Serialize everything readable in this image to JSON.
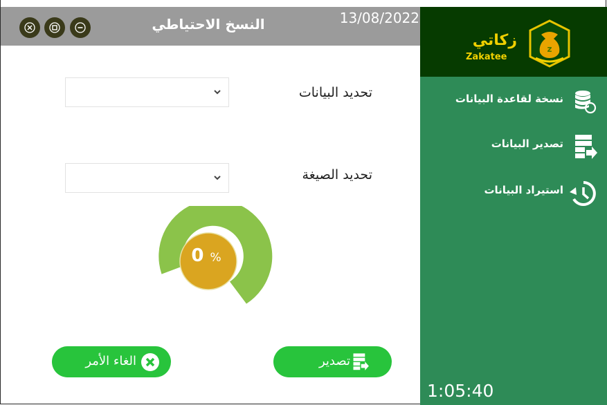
{
  "window": {
    "title": "النسخ الاحتياطي",
    "date": "13/08/2022",
    "controls": [
      "close-icon",
      "maximize-icon",
      "minimize-icon"
    ]
  },
  "brand": {
    "name": "زكاتي",
    "latin": "Zakatee"
  },
  "sidebar": {
    "items": [
      {
        "label": "نسخة لقاعدة البيانات",
        "icon": "database-backup-icon"
      },
      {
        "label": "تصدير البيانات",
        "icon": "export-data-icon"
      },
      {
        "label": "استيراد البيانات",
        "icon": "restore-history-icon"
      }
    ],
    "clock": "1:05:40"
  },
  "form": {
    "data_label": "تحديد البيانات",
    "data_value": "",
    "format_label": "تحديد الصيغة",
    "format_value": ""
  },
  "progress": {
    "value": "0",
    "unit": "%",
    "fraction": 0
  },
  "buttons": {
    "cancel": "الغاء الأمر",
    "export": "تصدير"
  },
  "colors": {
    "titlebar": "#9b9b9b",
    "sidebar": "#2e8b57",
    "brand_bg": "#063b00",
    "brand_text": "#f0d000",
    "gauge_ring": "#8bc34a",
    "gauge_center": "#daa520",
    "button": "#28c43c"
  }
}
